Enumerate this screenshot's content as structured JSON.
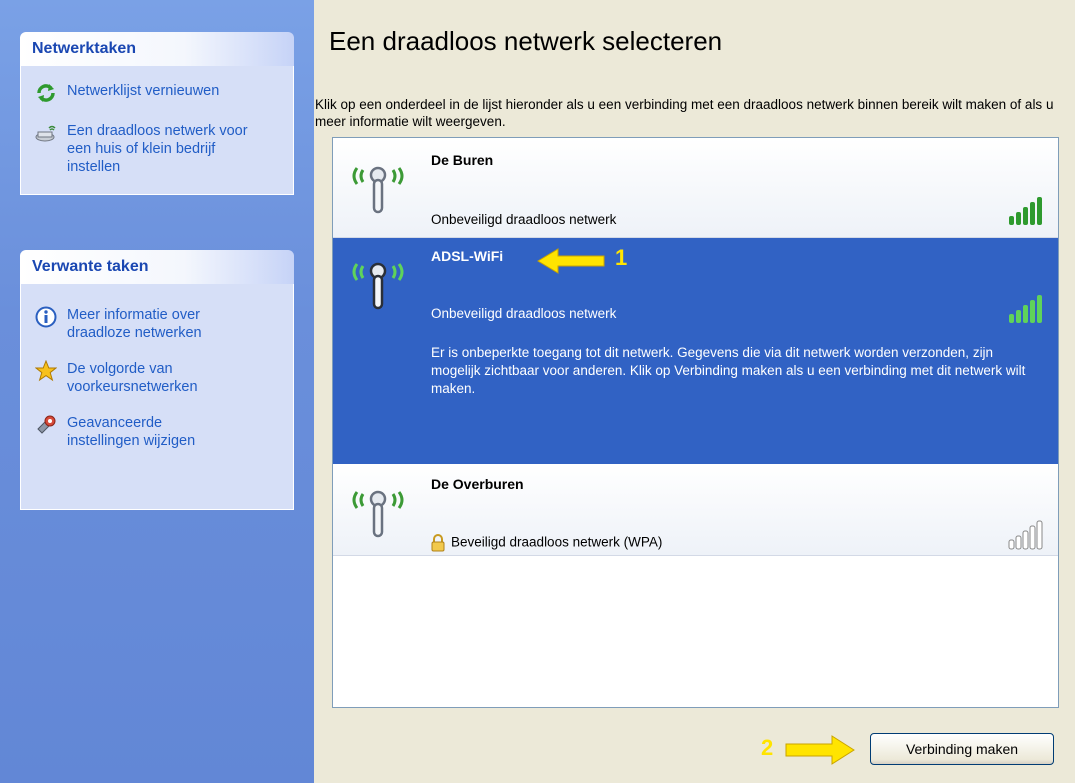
{
  "left_pane": {
    "network_tasks": {
      "header": "Netwerktaken",
      "items": [
        {
          "label": "Netwerklijst vernieuwen",
          "icon": "refresh-icon"
        },
        {
          "label": "Een draadloos netwerk voor een huis of klein bedrijf instellen",
          "icon": "wireless-setup-icon"
        }
      ]
    },
    "related_tasks": {
      "header": "Verwante taken",
      "items": [
        {
          "label": "Meer informatie over draadloze netwerken",
          "icon": "info-icon"
        },
        {
          "label": "De volgorde van voorkeursnetwerken",
          "icon": "star-icon"
        },
        {
          "label": "Geavanceerde instellingen wijzigen",
          "icon": "settings-icon"
        }
      ]
    }
  },
  "main": {
    "title": "Een draadloos netwerk selecteren",
    "description": "Klik op een onderdeel in de lijst hieronder als u een verbinding met een draadloos netwerk binnen bereik wilt maken of als u meer informatie wilt weergeven.",
    "networks": [
      {
        "name": "De Buren",
        "status": "Onbeveiligd draadloos netwerk",
        "secured": false,
        "selected": false,
        "signal_bars": 5
      },
      {
        "name": "ADSL-WiFi",
        "status": "Onbeveiligd draadloos netwerk",
        "secured": false,
        "selected": true,
        "signal_bars": 5,
        "info": "Er is onbeperkte toegang tot dit netwerk. Gegevens die via dit netwerk worden verzonden, zijn mogelijk zichtbaar voor anderen. Klik op Verbinding maken als u een verbinding met dit netwerk wilt maken."
      },
      {
        "name": "De Overburen",
        "status": "Beveiligd draadloos netwerk (WPA)",
        "secured": true,
        "selected": false,
        "signal_bars": 0
      }
    ],
    "connect_button": "Verbinding maken"
  },
  "annotations": {
    "arrow1_label": "1",
    "arrow2_label": "2"
  },
  "colors": {
    "left_pane": "#6a8fdb",
    "task_header_text": "#1a47b2",
    "task_link": "#215dc6",
    "selected_row": "#3162c4",
    "signal_green": "#2e9a2e",
    "annotation_yellow": "#ffe400"
  }
}
